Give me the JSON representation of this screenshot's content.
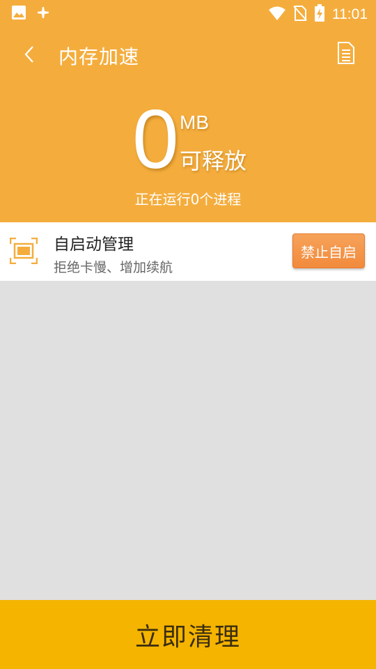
{
  "status_bar": {
    "time": "11:01",
    "icons": [
      "image-icon",
      "cleaner-icon",
      "wifi-icon",
      "no-sim-icon",
      "battery-charging-icon"
    ]
  },
  "header": {
    "title": "内存加速",
    "back_icon": "chevron-left-icon",
    "doc_icon": "document-icon",
    "freeable_amount": "0",
    "unit": "MB",
    "releasable_label": "可释放",
    "process_text": "正在运行0个进程"
  },
  "autostart": {
    "icon": "screen-frame-icon",
    "title": "自启动管理",
    "subtitle": "拒绝卡慢、增加续航",
    "button_label": "禁止自启"
  },
  "footer": {
    "clean_label": "立即清理"
  },
  "colors": {
    "header_bg": "#f4ad3d",
    "button_orange": "#f28a3c",
    "footer_bg": "#f4b400",
    "list_bg": "#e0e0e0"
  }
}
